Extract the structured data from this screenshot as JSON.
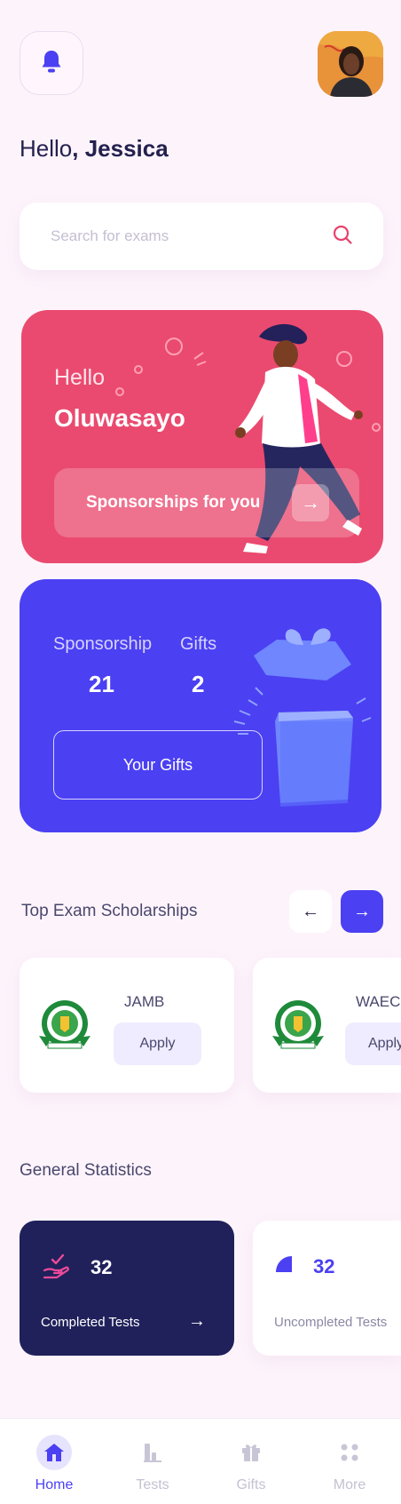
{
  "header": {
    "greeting_prefix": "Hello",
    "greeting_name": ", Jessica"
  },
  "search": {
    "placeholder": "Search for exams"
  },
  "hero": {
    "hello": "Hello",
    "name": "Oluwasayo",
    "button_label": "Sponsorships for you",
    "arrow": "→"
  },
  "sponsorship_card": {
    "sponsorship_label": "Sponsorship",
    "sponsorship_value": "21",
    "gifts_label": "Gifts",
    "gifts_value": "2",
    "button_label": "Your Gifts"
  },
  "scholarships": {
    "title": "Top Exam Scholarships",
    "prev": "←",
    "next": "→",
    "items": [
      {
        "name": "JAMB",
        "apply_label": "Apply"
      },
      {
        "name": "WAEC",
        "apply_label": "Apply"
      }
    ]
  },
  "statistics": {
    "title": "General Statistics",
    "items": [
      {
        "value": "32",
        "label": "Completed Tests",
        "arrow": "→"
      },
      {
        "value": "32",
        "label": "Uncompleted Tests"
      }
    ]
  },
  "bottom_nav": {
    "items": [
      {
        "label": "Home",
        "icon": "home-icon",
        "active": true
      },
      {
        "label": "Tests",
        "icon": "bar-chart-icon",
        "active": false
      },
      {
        "label": "Gifts",
        "icon": "gift-icon",
        "active": false
      },
      {
        "label": "More",
        "icon": "dots-grid-icon",
        "active": false
      }
    ]
  },
  "colors": {
    "background": "#fdf4fb",
    "primary": "#4b40f2",
    "pink": "#ea4a6f",
    "navy": "#20215b"
  }
}
